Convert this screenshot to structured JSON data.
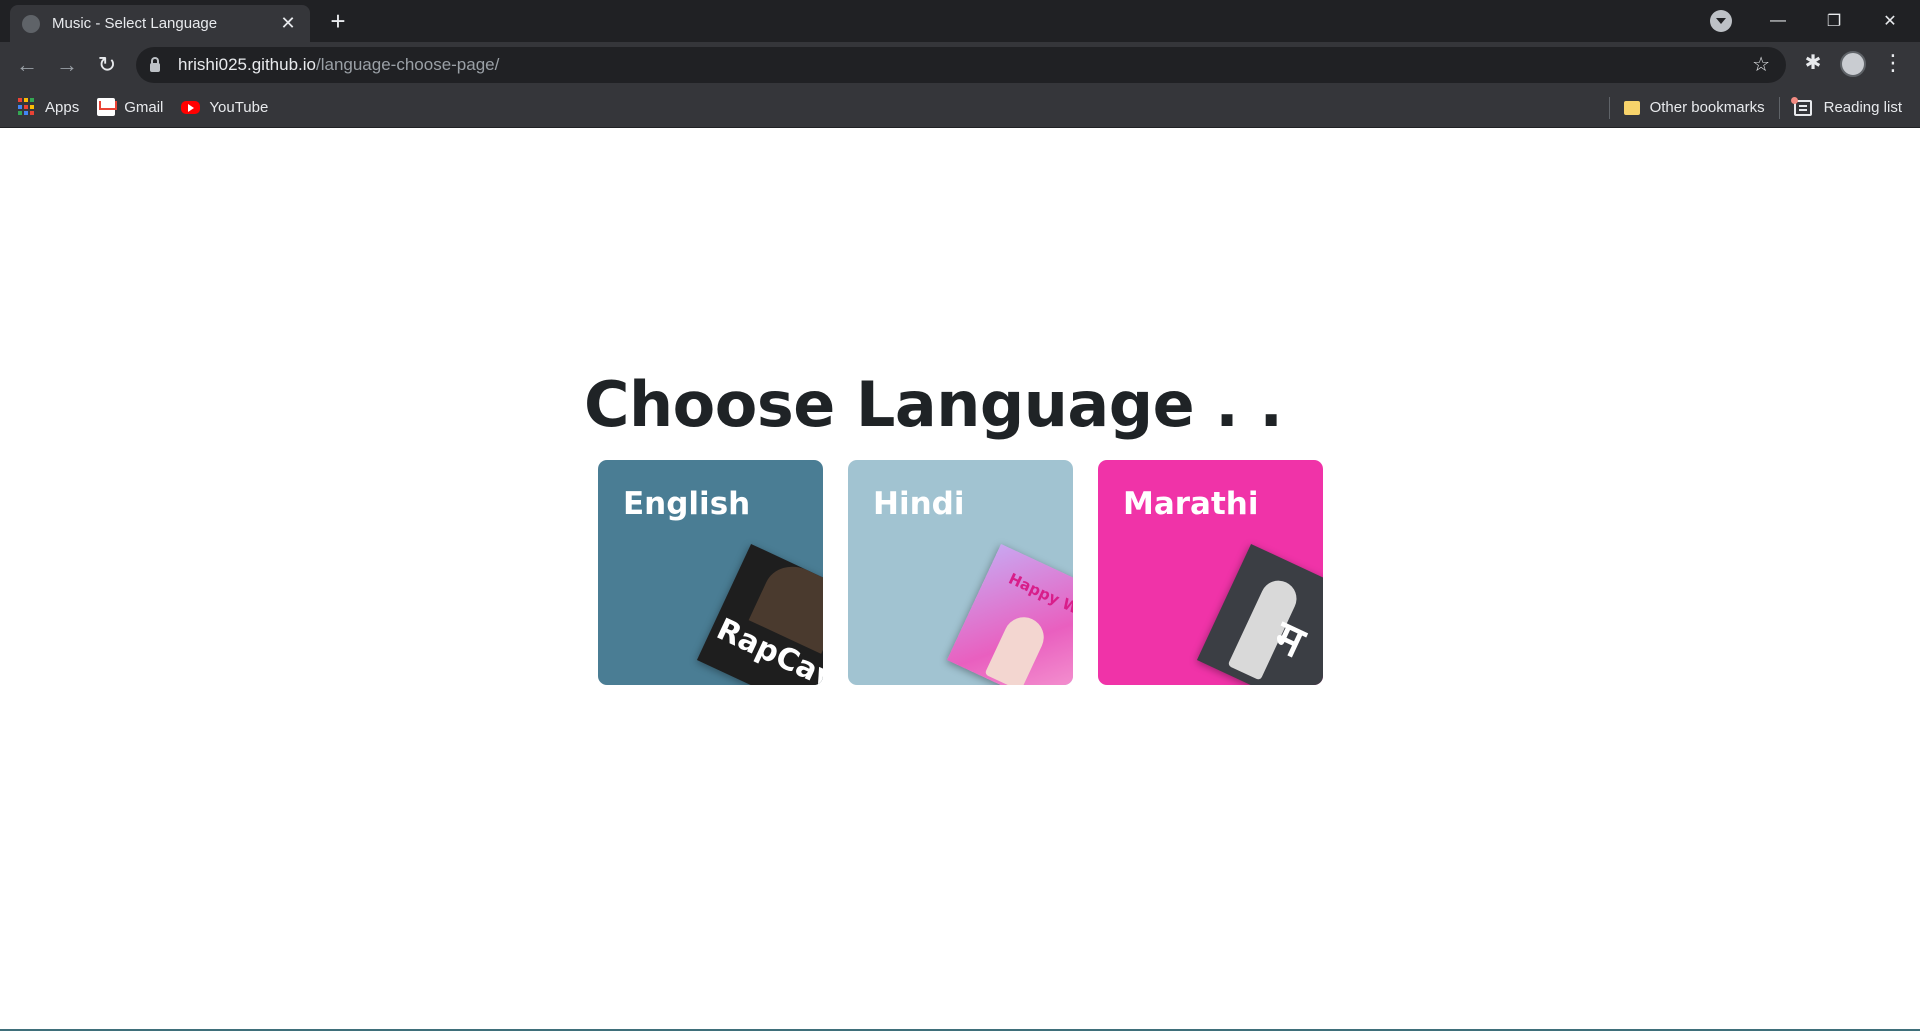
{
  "browser": {
    "tab_title": "Music - Select Language",
    "tab_close": "✕",
    "new_tab": "+",
    "window_controls": {
      "minimize": "—",
      "restore": "❐",
      "close": "✕"
    },
    "url_host": "hrishi025.github.io",
    "url_path": "/language-choose-page/",
    "bookmarks": [
      {
        "label": "Apps",
        "icon": "apps-grid-icon"
      },
      {
        "label": "Gmail",
        "icon": "gmail-icon"
      },
      {
        "label": "YouTube",
        "icon": "youtube-icon"
      }
    ],
    "other_bookmarks": "Other bookmarks",
    "reading_list": "Reading list"
  },
  "page": {
    "heading": "Choose Language . .",
    "cards": [
      {
        "label": "English",
        "bg": "#4a7d94",
        "cover_text": "RapCavi",
        "cover_bg": "#1e1e1e",
        "cover_text_color": "#ffffff"
      },
      {
        "label": "Hindi",
        "bg": "#a1c3d1",
        "cover_text": "Happy Week",
        "cover_bg": "#e95fbf",
        "cover_text_color": "#d81e8a"
      },
      {
        "label": "Marathi",
        "bg": "#f033a8",
        "cover_text": "म",
        "cover_bg": "#3b3e44",
        "cover_text_color": "#ffffff"
      }
    ]
  },
  "colors": {
    "chrome_dark": "#202124",
    "chrome_toolbar": "#35363a",
    "heading_text": "#1f2326"
  }
}
